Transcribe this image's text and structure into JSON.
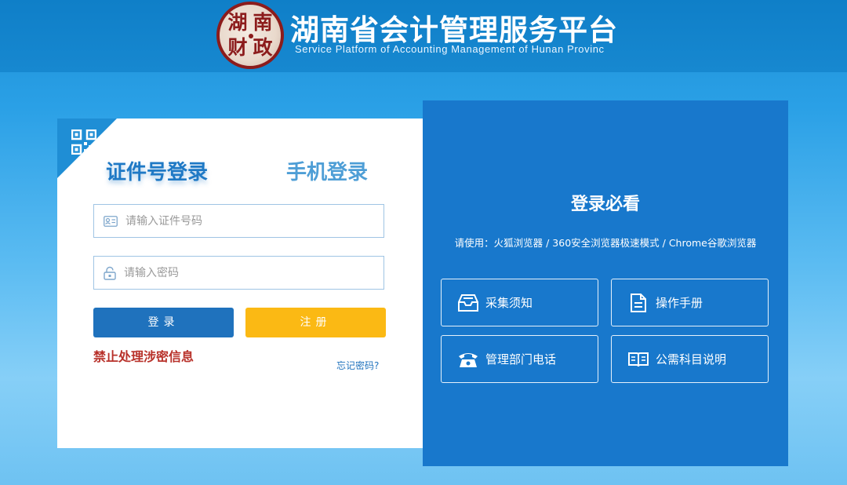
{
  "header": {
    "seal_chars": [
      "湖",
      "南",
      "财",
      "政"
    ],
    "title_cn": "湖南省会计管理服务平台",
    "title_en": "Service Platform of Accounting Management of Hunan Provinc"
  },
  "login": {
    "tabs": [
      {
        "label": "证件号登录",
        "active": true
      },
      {
        "label": "手机登录",
        "active": false
      }
    ],
    "id_field": {
      "placeholder": "请输入证件号码",
      "value": ""
    },
    "password_field": {
      "placeholder": "请输入密码",
      "value": ""
    },
    "login_label": "登录",
    "register_label": "注册",
    "warning": "禁止处理涉密信息",
    "forgot_label": "忘记密码?"
  },
  "info": {
    "title": "登录必看",
    "browsers_note": "请使用：火狐浏览器 / 360安全浏览器极速模式 / Chrome谷歌浏览器",
    "buttons": [
      {
        "label": "采集须知",
        "icon": "inbox-icon"
      },
      {
        "label": "操作手册",
        "icon": "document-icon"
      },
      {
        "label": "管理部门电话",
        "icon": "telephone-icon"
      },
      {
        "label": "公需科目说明",
        "icon": "open-book-icon"
      }
    ]
  },
  "colors": {
    "header_bg": "#1788d0",
    "primary_blue": "#1f72bd",
    "register_yellow": "#fbb914",
    "warning_red": "#b8312a",
    "panel_blue": "#1878cc"
  }
}
